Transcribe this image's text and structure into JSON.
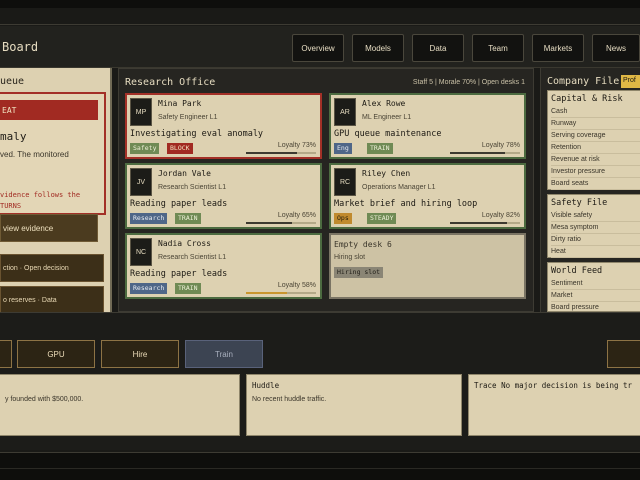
{
  "app": {
    "brand": "Board"
  },
  "nav": [
    "Overview",
    "Models",
    "Data",
    "Team",
    "Markets",
    "News"
  ],
  "queue": {
    "title": "ueue",
    "alert": {
      "head": "EAT",
      "title": "maly",
      "body": "ved. The monitored",
      "turns": "TURNS",
      "follow": "vidence follows the",
      "button": "view evidence"
    },
    "items": [
      "ction · Open decision",
      "o reserves · Data"
    ]
  },
  "office": {
    "title": "Research Office",
    "stats": "Staff 5 | Morale 70% | Open desks 1",
    "cards": [
      {
        "initials": "MP",
        "name": "Mina Park",
        "role": "Safety Engineer L1",
        "task": "Investigating eval anomaly",
        "tag1": "Safety",
        "tag2": "BLOCK",
        "loyalty": "Loyalty 73%",
        "loyalty_value": 73
      },
      {
        "initials": "AR",
        "name": "Alex Rowe",
        "role": "ML Engineer L1",
        "task": "GPU queue maintenance",
        "tag1": "Eng",
        "tag2": "TRAIN",
        "loyalty": "Loyalty 78%",
        "loyalty_value": 78
      },
      {
        "initials": "JV",
        "name": "Jordan Vale",
        "role": "Research Scientist L1",
        "task": "Reading paper leads",
        "tag1": "Research",
        "tag2": "TRAIN",
        "loyalty": "Loyalty 65%",
        "loyalty_value": 65
      },
      {
        "initials": "RC",
        "name": "Riley Chen",
        "role": "Operations Manager L1",
        "task": "Market brief and hiring loop",
        "tag1": "Ops",
        "tag2": "STEADY",
        "loyalty": "Loyalty 82%",
        "loyalty_value": 82
      },
      {
        "initials": "NC",
        "name": "Nadia Cross",
        "role": "Research Scientist L1",
        "task": "Reading paper leads",
        "tag1": "Research",
        "tag2": "TRAIN",
        "loyalty": "Loyalty 58%",
        "loyalty_value": 58
      }
    ],
    "empty": {
      "title": "Empty desk 6",
      "sub": "Hiring slot",
      "tag": "Hiring slot"
    }
  },
  "company": {
    "title": "Company File",
    "badge": "Prof",
    "capital": {
      "title": "Capital & Risk",
      "rows": [
        "Cash",
        "Runway",
        "Serving coverage",
        "Retention",
        "Revenue at risk",
        "Investor pressure",
        "Board seats"
      ]
    },
    "safety": {
      "title": "Safety File",
      "rows": [
        "Visible safety",
        "Mesa symptom",
        "Dirty ratio",
        "Heat"
      ]
    },
    "world": {
      "title": "World Feed",
      "rows": [
        "Sentiment",
        "Market",
        "Board pressure"
      ]
    }
  },
  "actions": {
    "gpu": "GPU",
    "hire": "Hire",
    "train": "Train"
  },
  "logs": {
    "left_text": "y founded with $500,000.",
    "huddle_title": "Huddle",
    "huddle_text": "No recent huddle traffic.",
    "trace_title": "Trace No major decision is being tr"
  },
  "colors": {
    "accent_red": "#a12a22",
    "card_green": "#4c6b40",
    "bg": "#1a1a17",
    "paper": "#ddd1b1"
  }
}
